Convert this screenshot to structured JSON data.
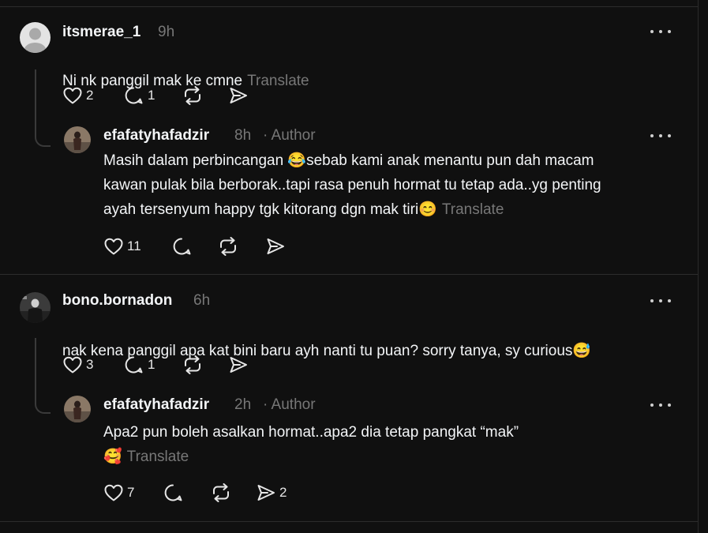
{
  "comments": [
    {
      "username": "itsmerae_1",
      "time": "9h",
      "text": "Ni nk panggil mak ke cmne",
      "translate_label": "Translate",
      "likes": "2",
      "replies": "1",
      "reposts": "",
      "shares": "",
      "reply": {
        "username": "efafatyhafadzir",
        "time": "8h",
        "author_badge": "· Author",
        "text_part1": "Masih dalam perbincangan ",
        "emoji1": "😂",
        "text_part2": "sebab kami anak menantu pun dah macam\nkawan pulak bila berborak..tapi rasa penuh hormat tu tetap ada..yg penting\nayah tersenyum happy tgk kitorang dgn mak tiri",
        "emoji2": "😊",
        "translate_label": "Translate",
        "likes": "11",
        "replies": "",
        "reposts": "",
        "shares": ""
      }
    },
    {
      "username": "bono.bornadon",
      "time": "6h",
      "text": "nak kena panggil apa kat bini baru ayh nanti tu puan? sorry tanya, sy curious",
      "emoji": "😅",
      "likes": "3",
      "replies": "1",
      "reposts": "",
      "shares": "",
      "reply": {
        "username": "efafatyhafadzir",
        "time": "2h",
        "author_badge": "· Author",
        "text": "Apa2 pun boleh asalkan hormat..apa2 dia tetap pangkat “mak”",
        "emoji": "🥰",
        "translate_label": "Translate",
        "likes": "7",
        "replies": "",
        "reposts": "",
        "shares": "2"
      }
    }
  ],
  "icons": {
    "like": "heart-icon",
    "reply": "comment-bubble-icon",
    "repost": "repost-icon",
    "share": "share-arrow-icon",
    "more": "more-dots-icon"
  },
  "colors": {
    "background": "#101010",
    "text": "#f3f5f7",
    "muted": "#777777",
    "divider": "#2c2c2c"
  }
}
